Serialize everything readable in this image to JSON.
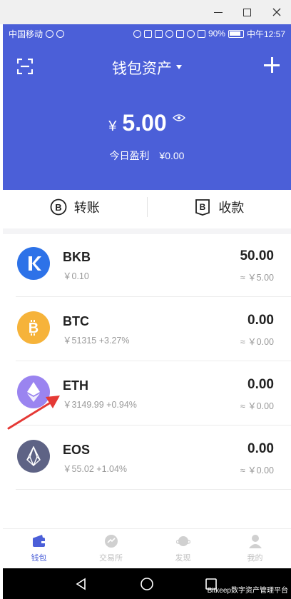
{
  "status_bar": {
    "carrier": "中国移动",
    "battery": "90%",
    "time": "中午12:57"
  },
  "header": {
    "title": "钱包资产",
    "balance_currency": "¥",
    "balance": "5.00",
    "profit_label": "今日盈利",
    "profit_value": "¥0.00",
    "bg_color": "#4b5fd8"
  },
  "actions": [
    {
      "label": "转账",
      "icon": "bitcoin-circle-icon"
    },
    {
      "label": "收款",
      "icon": "bitcoin-shield-icon"
    }
  ],
  "assets": [
    {
      "name": "BKB",
      "price": "￥0.10",
      "change": "",
      "amount": "50.00",
      "value": "≈ ￥5.00",
      "icon_color": "#2d72e8",
      "icon": "bkb-icon"
    },
    {
      "name": "BTC",
      "price": "￥51315",
      "change": "+3.27%",
      "amount": "0.00",
      "value": "≈ ￥0.00",
      "icon_color": "#f6b33a",
      "icon": "bitcoin-icon"
    },
    {
      "name": "ETH",
      "price": "￥3149.99",
      "change": "+0.94%",
      "amount": "0.00",
      "value": "≈ ￥0.00",
      "icon_color": "#9a84f0",
      "icon": "ethereum-icon"
    },
    {
      "name": "EOS",
      "price": "￥55.02",
      "change": "+1.04%",
      "amount": "0.00",
      "value": "≈ ￥0.00",
      "icon_color": "#5e6385",
      "icon": "eos-icon"
    }
  ],
  "tabs": [
    {
      "label": "钱包",
      "icon": "wallet-icon",
      "active": true
    },
    {
      "label": "交易所",
      "icon": "exchange-icon",
      "active": false
    },
    {
      "label": "发现",
      "icon": "planet-icon",
      "active": false
    },
    {
      "label": "我的",
      "icon": "person-icon",
      "active": false
    }
  ],
  "watermark": "Bitkeep数字资产管理平台"
}
